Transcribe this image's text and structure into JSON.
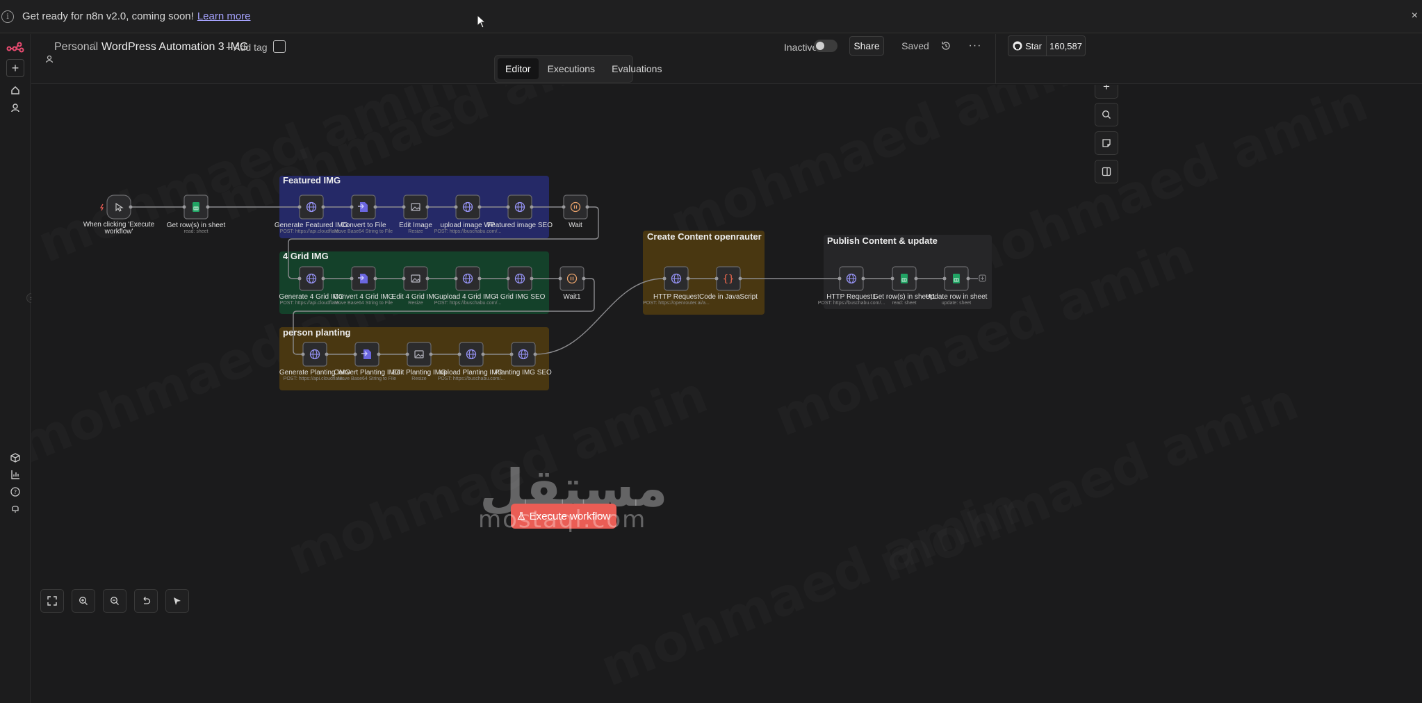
{
  "banner": {
    "text": "Get ready for n8n v2.0, coming soon!",
    "link": "Learn more",
    "close": "×"
  },
  "header": {
    "owner": "Personal",
    "separator": "/",
    "workflow_title": "WordPress Automation 3 IMG",
    "add_tag": "+ Add tag",
    "status_label": "Inactive",
    "share": "Share",
    "saved": "Saved",
    "github_star": "Star",
    "github_count": "160,587"
  },
  "tabs": [
    {
      "label": "Editor"
    },
    {
      "label": "Executions"
    },
    {
      "label": "Evaluations"
    }
  ],
  "groups": {
    "featured": "Featured IMG",
    "grid": "4 Grid IMG",
    "planting": "person planting",
    "content": "Create Content openrauter",
    "publish": "Publish Content & update"
  },
  "nodes": {
    "trigger": {
      "label1": "When clicking 'Execute",
      "label2": "workflow'"
    },
    "getrows": {
      "label": "Get row(s) in sheet",
      "sub": "read: sheet"
    },
    "gen_featured": {
      "label": "Generate Featured IMG",
      "sub": "POST: https://api.cloudflare..."
    },
    "convert_file": {
      "label": "Convert to File",
      "sub": "Move Base64 String to File"
    },
    "edit_image": {
      "label": "Edit Image",
      "sub": "Resize"
    },
    "upload_wp": {
      "label": "upload image WP",
      "sub": "POST: https://buschabu.com/..."
    },
    "featured_seo": {
      "label": "Featured image SEO",
      "sub": ""
    },
    "wait": {
      "label": "Wait",
      "sub": ""
    },
    "gen_grid": {
      "label": "Generate 4 Grid IMG",
      "sub": "POST: https://api.cloudflare..."
    },
    "convert_grid": {
      "label": "Convert 4 Grid IMG",
      "sub": "Move Base64 String to File"
    },
    "edit_grid": {
      "label": "Edit 4 Grid IMG",
      "sub": "Resize"
    },
    "upload_grid": {
      "label": "upload 4 Grid IMG",
      "sub": "POST: https://buschabu.com/..."
    },
    "grid_seo": {
      "label": "4 Grid IMG SEO",
      "sub": ""
    },
    "wait1": {
      "label": "Wait1",
      "sub": ""
    },
    "gen_planting": {
      "label": "Generate Planting IMG",
      "sub": "POST: https://api.cloudflare..."
    },
    "convert_planting": {
      "label": "Convert Planting IMG",
      "sub": "Move Base64 String to File"
    },
    "edit_planting": {
      "label": "Edit Planting IMG",
      "sub": "Resize"
    },
    "upload_planting": {
      "label": "upload Planting IMG",
      "sub": "POST: https://buschabu.com/..."
    },
    "planting_seo": {
      "label": "Planting IMG SEO",
      "sub": ""
    },
    "http": {
      "label": "HTTP Request",
      "sub": "POST: https://openrouter.ai/a..."
    },
    "code": {
      "label": "Code in JavaScript",
      "sub": ""
    },
    "http1": {
      "label": "HTTP Request1",
      "sub": "POST: https://buschabu.com/..."
    },
    "getrows1": {
      "label": "Get row(s) in sheet1",
      "sub": "read: sheet"
    },
    "update": {
      "label": "Update row in sheet",
      "sub": "update: sheet"
    }
  },
  "execute_button": "Execute workflow",
  "watermark_text": "mohmaed amin",
  "logo": {
    "arabic": "مستقل",
    "latin": "mostaql.com"
  },
  "colors": {
    "featured_bg": "#262a6e",
    "grid_bg": "#13442b",
    "planting_bg": "#4d3a10",
    "content_bg": "#4d3a10",
    "publish_bg": "#262628",
    "accent": "#ea5d55",
    "globe": "#8e8cf4"
  },
  "icons": {
    "trigger": "cursor-click-icon",
    "sheet": "google-sheets-icon",
    "http": "globe-icon",
    "convert": "file-convert-icon",
    "edit": "image-icon",
    "wait": "pause-icon",
    "code": "code-braces-icon"
  }
}
